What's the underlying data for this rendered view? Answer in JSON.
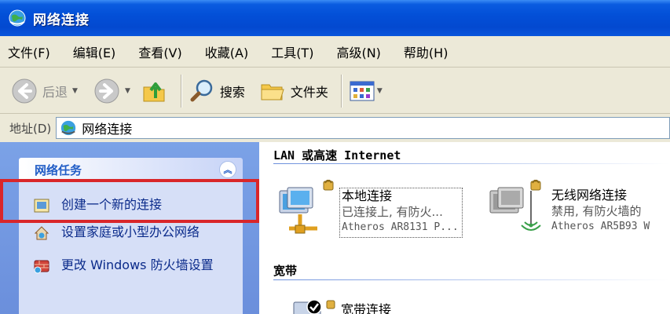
{
  "window": {
    "title": "网络连接"
  },
  "menu": [
    "文件(F)",
    "编辑(E)",
    "查看(V)",
    "收藏(A)",
    "工具(T)",
    "高级(N)",
    "帮助(H)"
  ],
  "toolbar": {
    "back_label": "后退",
    "search_label": "搜索",
    "folders_label": "文件夹"
  },
  "address": {
    "label": "地址(D)",
    "value": "网络连接"
  },
  "tasks": {
    "title": "网络任务",
    "items": [
      "创建一个新的连接",
      "设置家庭或小型办公网络",
      "更改 Windows 防火墙设置"
    ]
  },
  "groups": {
    "lan_title": "LAN 或高速 Internet",
    "broadband_title": "宽带"
  },
  "connections": [
    {
      "name": "本地连接",
      "status": "已连接上, 有防火...",
      "device": "Atheros AR8131 P..."
    },
    {
      "name": "无线网络连接",
      "status": "禁用, 有防火墙的",
      "device": "Atheros AR5B93 W"
    },
    {
      "name": "宽带连接"
    }
  ],
  "colors": {
    "highlight": "#d9262a",
    "titlebar": "#0350d8",
    "task_link": "#0a2a8a"
  }
}
